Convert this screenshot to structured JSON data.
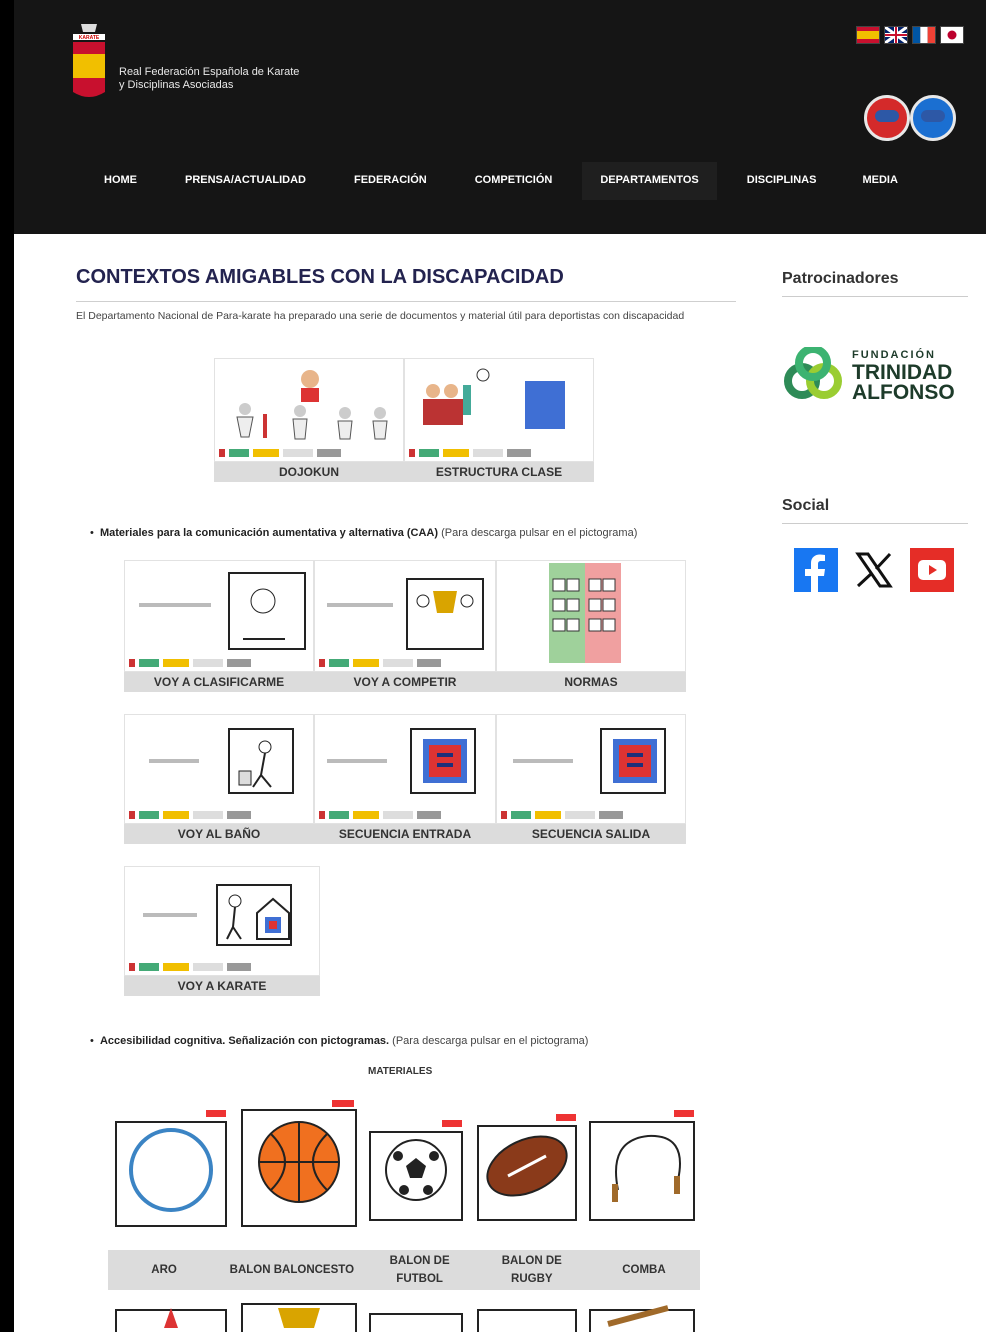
{
  "header": {
    "federation_name_line1": "Real Federación Española de Karate",
    "federation_name_line2": "y Disciplinas Asociadas",
    "crest_text": "KARATE"
  },
  "nav": {
    "items": [
      {
        "label": "HOME"
      },
      {
        "label": "PRENSA/ACTUALIDAD"
      },
      {
        "label": "FEDERACIÓN"
      },
      {
        "label": "COMPETICIÓN"
      },
      {
        "label": "DEPARTAMENTOS",
        "active": true
      },
      {
        "label": "DISCIPLINAS"
      },
      {
        "label": "MEDIA"
      }
    ]
  },
  "main": {
    "title": "CONTEXTOS AMIGABLES CON LA DISCAPACIDAD",
    "intro": "El Departamento Nacional de Para-karate ha preparado una serie de documentos y material útil para deportistas con discapacidad",
    "top_cards": [
      {
        "caption": "DOJOKUN"
      },
      {
        "caption": "ESTRUCTURA CLASE"
      }
    ],
    "caa": {
      "bold": "Materiales para la comunicación aumentativa y alternativa (CAA)",
      "note": "(Para descarga pulsar en el pictograma)",
      "cards": [
        {
          "caption": "VOY A CLASIFICARME"
        },
        {
          "caption": "VOY A COMPETIR"
        },
        {
          "caption": "NORMAS"
        },
        {
          "caption": "VOY AL BAÑO"
        },
        {
          "caption": "SECUENCIA ENTRADA"
        },
        {
          "caption": "SECUENCIA SALIDA"
        },
        {
          "caption": "VOY A KARATE"
        }
      ]
    },
    "accesibilidad": {
      "bold": "Accesibilidad cognitiva. Señalización con pictogramas.",
      "note": "(Para descarga pulsar en el pictograma)",
      "subtitle": "MATERIALES",
      "items": [
        {
          "caption": "ARO"
        },
        {
          "caption": "BALON BALONCESTO"
        },
        {
          "caption": "BALON DE FUTBOL"
        },
        {
          "caption": "BALON DE RUGBY"
        },
        {
          "caption": "COMBA"
        }
      ]
    }
  },
  "sidebar": {
    "sponsors_title": "Patrocinadores",
    "sponsor_line1": "FUNDACIÓN",
    "sponsor_line2": "TRINIDAD",
    "sponsor_line3": "ALFONSO",
    "social_title": "Social",
    "social_icons": [
      "facebook-icon",
      "x-icon",
      "youtube-icon"
    ]
  },
  "colors": {
    "header_bg": "#151515",
    "title": "#23234f",
    "caption_bg": "#dcdcdc",
    "facebook": "#1877f2",
    "youtube": "#e52d27",
    "trinidad_green": "#2e8b57"
  }
}
